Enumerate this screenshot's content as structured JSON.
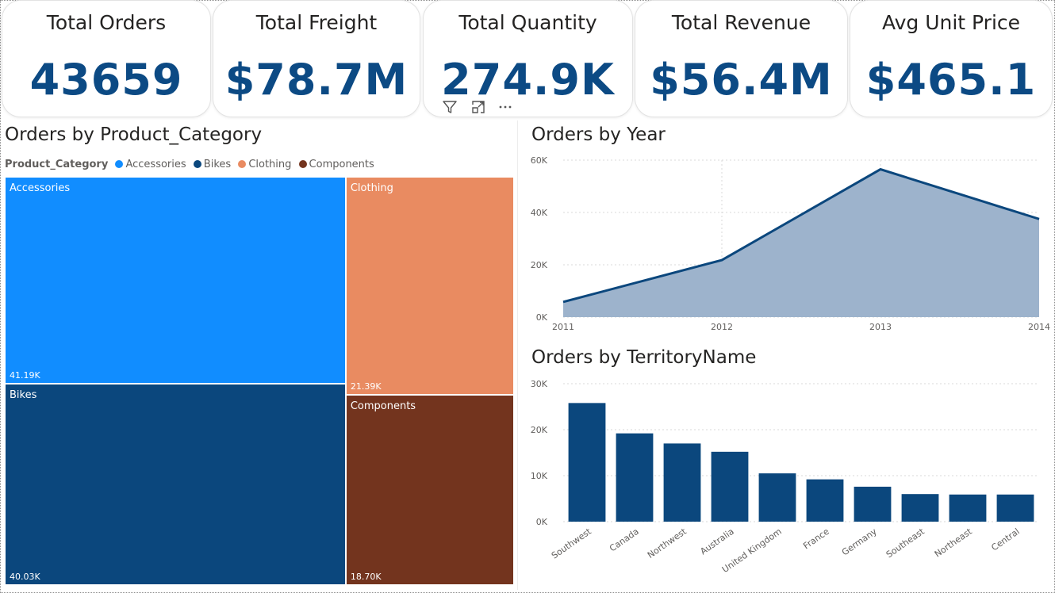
{
  "kpis": [
    {
      "label": "Total Orders",
      "value": "43659"
    },
    {
      "label": "Total Freight",
      "value": "$78.7M"
    },
    {
      "label": "Total Quantity",
      "value": "274.9K"
    },
    {
      "label": "Total Revenue",
      "value": "$56.4M"
    },
    {
      "label": "Avg Unit Price",
      "value": "$465.1"
    }
  ],
  "colors": {
    "kpi_value": "#0c4a84",
    "accessories": "#118dff",
    "bikes": "#0b477d",
    "clothing": "#e98b61",
    "components": "#73341e",
    "area_fill": "#9db3cc",
    "area_line": "#0b477d",
    "bar": "#0b477d"
  },
  "visual_header_icons": [
    "filter-icon",
    "focus-mode-icon",
    "more-options-icon"
  ],
  "chart_data": [
    {
      "type": "treemap",
      "title": "Orders by Product_Category",
      "legend_title": "Product_Category",
      "legend_placement": "top-left",
      "categories": [
        "Accessories",
        "Bikes",
        "Clothing",
        "Components"
      ],
      "values": [
        41190,
        40030,
        21390,
        18700
      ],
      "value_labels": [
        "41.19K",
        "40.03K",
        "21.39K",
        "18.70K"
      ]
    },
    {
      "type": "area",
      "title": "Orders by Year",
      "x": [
        "2011",
        "2012",
        "2013",
        "2014"
      ],
      "values": [
        5800,
        21800,
        56500,
        37500
      ],
      "ylim": [
        0,
        60000
      ],
      "yticks": [
        "0K",
        "20K",
        "40K",
        "60K"
      ],
      "ytick_values": [
        0,
        20000,
        40000,
        60000
      ],
      "grid": true
    },
    {
      "type": "bar",
      "title": "Orders by TerritoryName",
      "categories": [
        "Southwest",
        "Canada",
        "Northwest",
        "Australia",
        "United Kingdom",
        "France",
        "Germany",
        "Southeast",
        "Northeast",
        "Central"
      ],
      "values": [
        25800,
        19200,
        17000,
        15200,
        10500,
        9200,
        7600,
        6000,
        5900,
        5900
      ],
      "ylim": [
        0,
        30000
      ],
      "yticks": [
        "0K",
        "10K",
        "20K",
        "30K"
      ],
      "ytick_values": [
        0,
        10000,
        20000,
        30000
      ],
      "grid": true
    }
  ]
}
